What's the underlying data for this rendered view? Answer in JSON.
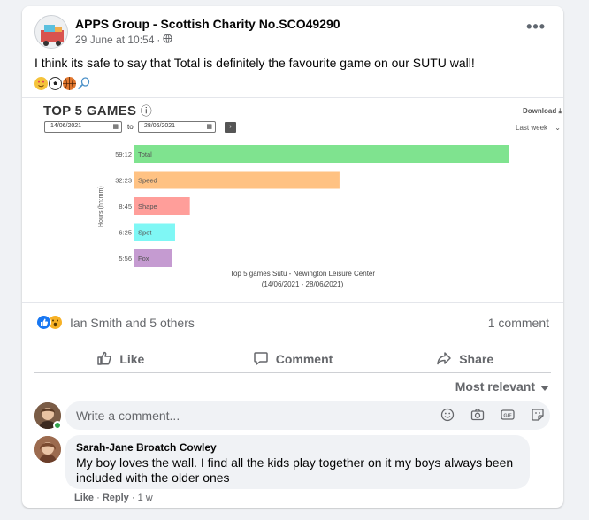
{
  "post": {
    "author": "APPS Group - Scottish Charity No.SCO49290",
    "timestamp": "29 June at 10:54",
    "dot": "·",
    "visibility_icon": "globe-icon",
    "more": "•••",
    "text": "I think its safe to say that Total is definitely the favourite game on our SUTU wall!",
    "emojis": [
      "heart-eyes-emoji",
      "football-emoji",
      "basketball-emoji",
      "tennis-emoji"
    ]
  },
  "chart": {
    "title": "TOP 5 GAMES",
    "info_icon": "ⓘ",
    "download_label": "Download",
    "date_from": "14/06/2021",
    "date_to": "28/06/2021",
    "to_label": "to",
    "go_label": "›",
    "range_label": "Last week",
    "caption_line1": "Top 5 games Sutu - Newington Leisure Center",
    "caption_line2": "(14/06/2021 - 28/06/2021)"
  },
  "chart_data": {
    "type": "bar",
    "orientation": "horizontal",
    "categories": [
      "Total",
      "Speed",
      "Shape",
      "Spot",
      "Fox"
    ],
    "labels": [
      "59:12",
      "32:23",
      "8:45",
      "6:25",
      "5:56"
    ],
    "values": [
      59.2,
      32.38,
      8.75,
      6.42,
      5.93
    ],
    "colors": [
      "#7fe38f",
      "#ffc283",
      "#ff9e9a",
      "#7ff7f5",
      "#c59bd1"
    ],
    "ylabel": "Hours (hh:mm)",
    "grid": false
  },
  "footer": {
    "reaction_icons": [
      "like-reaction-icon",
      "wow-reaction-icon"
    ],
    "reactions_text": "Ian Smith and 5 others",
    "comment_count": "1 comment",
    "like_label": "Like",
    "comment_label": "Comment",
    "share_label": "Share",
    "sort_label": "Most relevant"
  },
  "composer": {
    "placeholder": "Write a comment..."
  },
  "comment": {
    "name": "Sarah-Jane Broatch Cowley",
    "text": "My boy loves the wall. I find all the kids play together on it my boys always been included with the older ones",
    "like": "Like",
    "reply": "Reply",
    "sep": "·",
    "age": "1 w"
  }
}
